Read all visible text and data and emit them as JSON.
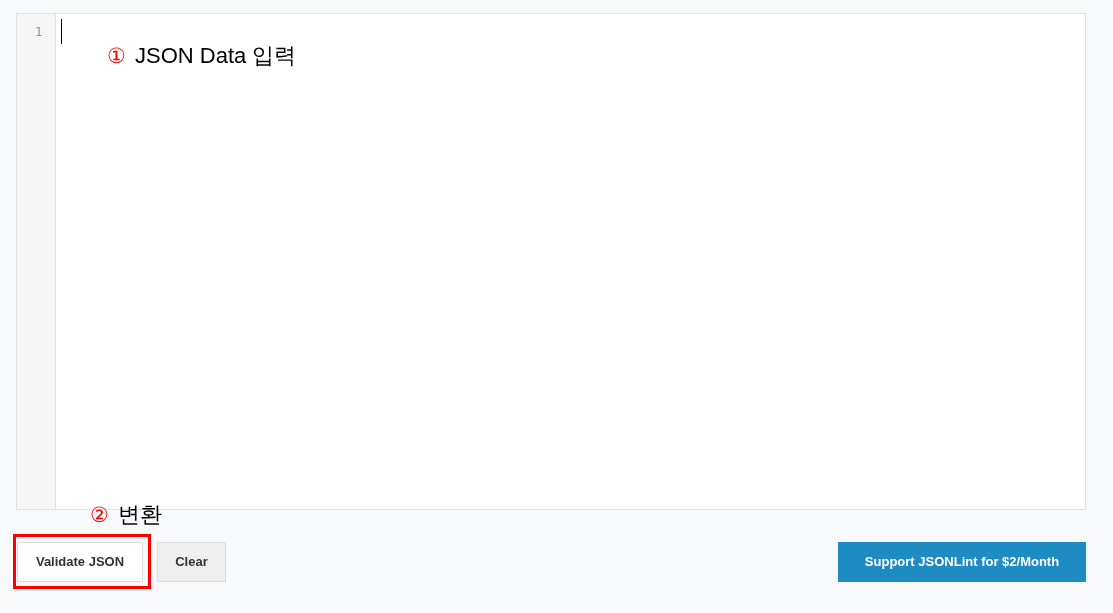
{
  "editor": {
    "line_numbers": [
      "1"
    ],
    "focused": true
  },
  "annotations": [
    {
      "number": "①",
      "text": "JSON Data 입력"
    },
    {
      "number": "②",
      "text": "변환"
    }
  ],
  "buttons": [
    {
      "label": "Validate JSON",
      "kind": "default",
      "highlighted": true
    },
    {
      "label": "Clear",
      "kind": "secondary",
      "highlighted": false
    },
    {
      "label": "Support JSONLint for $2/Month",
      "kind": "primary",
      "highlighted": false
    }
  ]
}
